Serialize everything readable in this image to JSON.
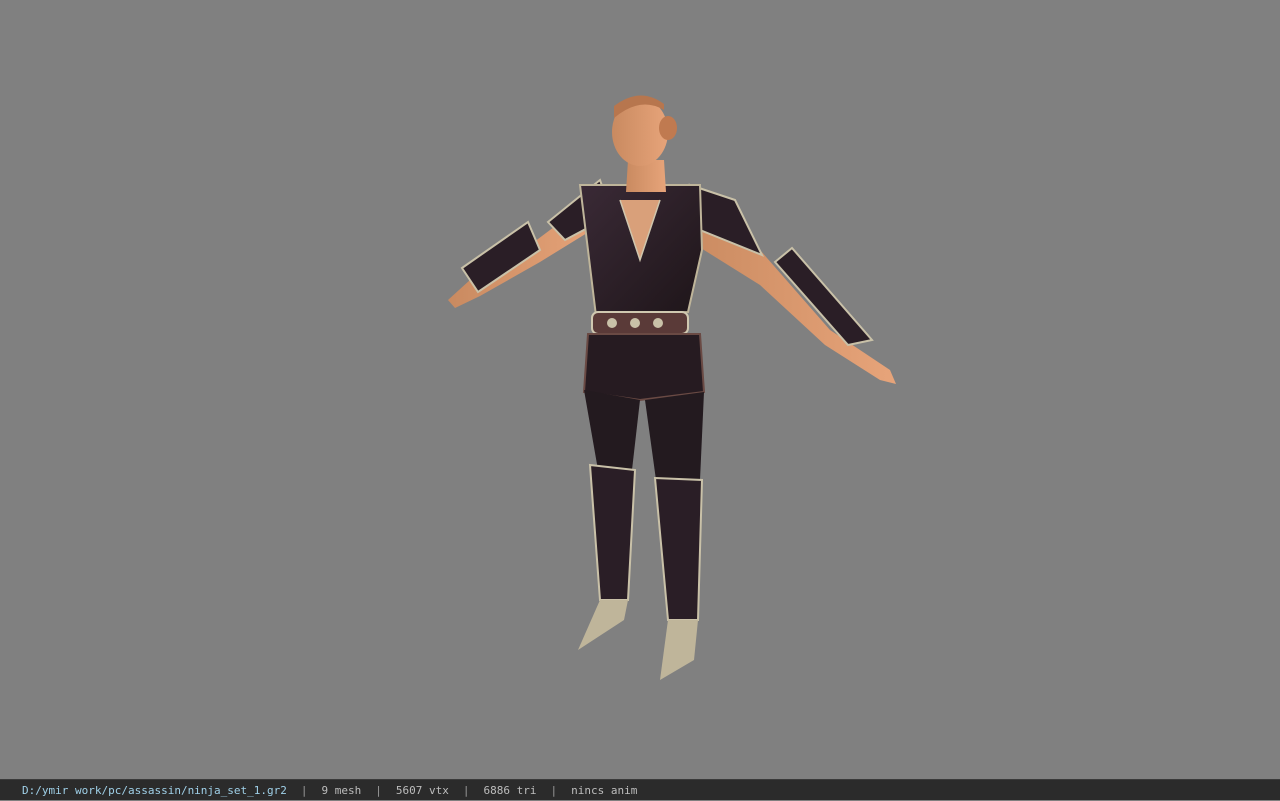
{
  "status_bar": {
    "file_path": "D:/ymir work/pc/assassin/ninja_set_1.gr2",
    "mesh_count": "9 mesh",
    "vertex_count": "5607 vtx",
    "triangle_count": "6886 tri",
    "anim_info": "nincs anim",
    "separator": "|"
  },
  "viewport": {
    "background_color": "#808080",
    "model_description_icon": "character-model-tpose"
  }
}
